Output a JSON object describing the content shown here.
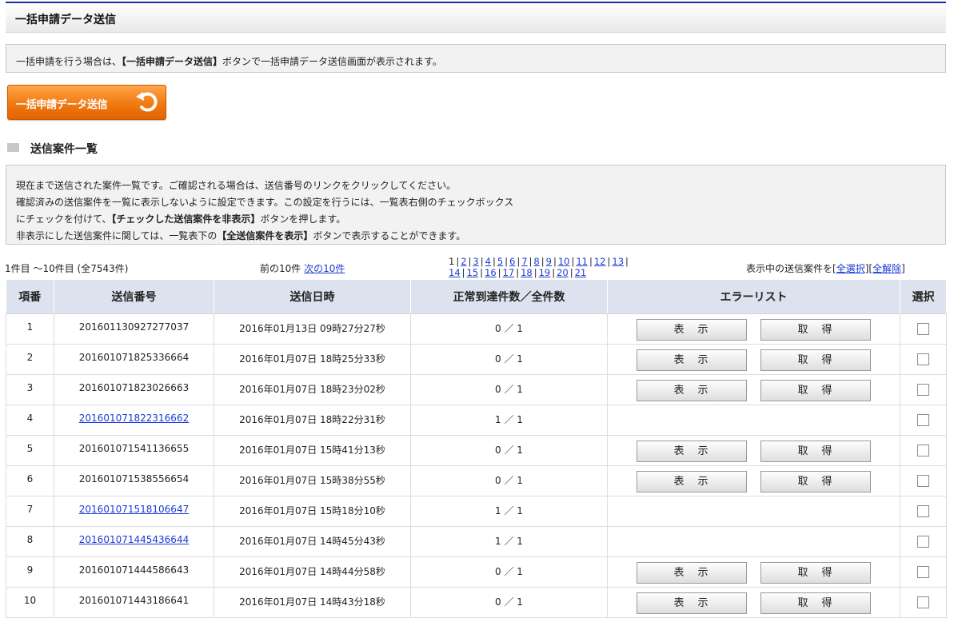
{
  "header": {
    "title": "一括申請データ送信"
  },
  "intro": {
    "text_pre": "一括申請を行う場合は、",
    "text_bold": "【一括申請データ送信】",
    "text_post": "ボタンで一括申請データ送信画面が表示されます。"
  },
  "bulk_button": {
    "label": "一括申請データ送信"
  },
  "section": {
    "title": "送信案件一覧"
  },
  "notes": {
    "line1": "現在まで送信された案件一覧です。ご確認される場合は、送信番号のリンクをクリックしてください。",
    "line2": "確認済みの送信案件を一覧に表示しないように設定できます。この設定を行うには、一覧表右側のチェックボックス",
    "line3_pre": "にチェックを付けて、",
    "line3_bold": "【チェックした送信案件を非表示】",
    "line3_post": "ボタンを押します。",
    "line4_pre": "非表示にした送信案件に関しては、一覧表下の",
    "line4_bold": "【全送信案件を表示】",
    "line4_post": "ボタンで表示することができます。"
  },
  "pager": {
    "range": "1件目 〜10件目 (全7543件)",
    "prev": "前の10件",
    "next": "次の10件",
    "current": "1",
    "pages_row1": [
      "2",
      "3",
      "4",
      "5",
      "6",
      "7",
      "8",
      "9",
      "10",
      "11",
      "12",
      "13"
    ],
    "pages_row2": [
      "14",
      "15",
      "16",
      "17",
      "18",
      "19",
      "20",
      "21"
    ],
    "select_pre": "表示中の送信案件を[",
    "select_all": "全選択",
    "select_mid": "][",
    "deselect_all": "全解除",
    "select_post": "]"
  },
  "table": {
    "headers": [
      "項番",
      "送信番号",
      "送信日時",
      "正常到達件数／全件数",
      "エラーリスト",
      "選択"
    ],
    "show_label": "表　示",
    "get_label": "取　得",
    "rows": [
      {
        "no": "1",
        "id": "201601130927277037",
        "date": "2016年01月13日 09時27分27秒",
        "count": "0 ／ 1",
        "link": false,
        "errors": true
      },
      {
        "no": "2",
        "id": "201601071825336664",
        "date": "2016年01月07日 18時25分33秒",
        "count": "0 ／ 1",
        "link": false,
        "errors": true
      },
      {
        "no": "3",
        "id": "201601071823026663",
        "date": "2016年01月07日 18時23分02秒",
        "count": "0 ／ 1",
        "link": false,
        "errors": true
      },
      {
        "no": "4",
        "id": "201601071822316662",
        "date": "2016年01月07日 18時22分31秒",
        "count": "1 ／ 1",
        "link": true,
        "errors": false
      },
      {
        "no": "5",
        "id": "201601071541136655",
        "date": "2016年01月07日 15時41分13秒",
        "count": "0 ／ 1",
        "link": false,
        "errors": true
      },
      {
        "no": "6",
        "id": "201601071538556654",
        "date": "2016年01月07日 15時38分55秒",
        "count": "0 ／ 1",
        "link": false,
        "errors": true
      },
      {
        "no": "7",
        "id": "201601071518106647",
        "date": "2016年01月07日 15時18分10秒",
        "count": "1 ／ 1",
        "link": true,
        "errors": false
      },
      {
        "no": "8",
        "id": "201601071445436644",
        "date": "2016年01月07日 14時45分43秒",
        "count": "1 ／ 1",
        "link": true,
        "errors": false
      },
      {
        "no": "9",
        "id": "201601071444586643",
        "date": "2016年01月07日 14時44分58秒",
        "count": "0 ／ 1",
        "link": false,
        "errors": true
      },
      {
        "no": "10",
        "id": "201601071443186641",
        "date": "2016年01月07日 14時43分18秒",
        "count": "0 ／ 1",
        "link": false,
        "errors": true
      }
    ]
  }
}
